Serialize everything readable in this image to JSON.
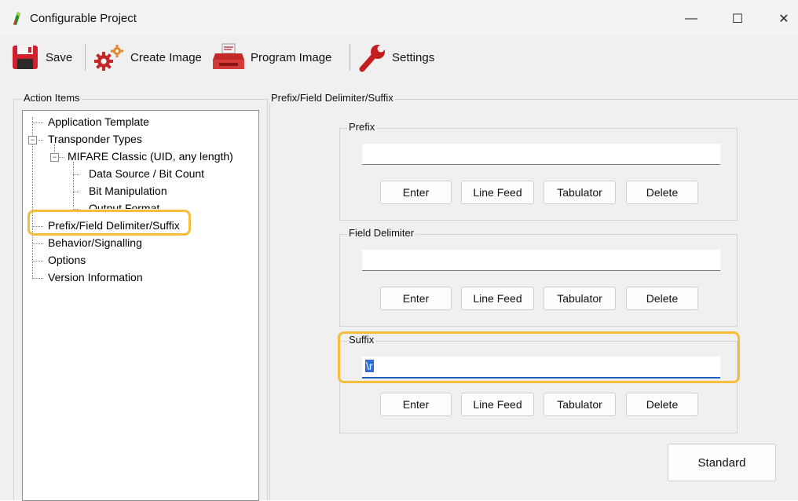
{
  "window": {
    "title": "Configurable Project"
  },
  "titlebar_buttons": {
    "minimize": "—",
    "maximize": "☐",
    "close": "✕"
  },
  "toolbar": {
    "save_label": "Save",
    "create_image_label": "Create Image",
    "program_image_label": "Program Image",
    "settings_label": "Settings"
  },
  "left_panel": {
    "title": "Action Items",
    "tree": [
      "Application Template",
      "Transponder Types",
      "MIFARE Classic (UID, any length)",
      "Data Source / Bit Count",
      "Bit Manipulation",
      "Output Format",
      "Prefix/Field Delimiter/Suffix",
      "Behavior/Signalling",
      "Options",
      "Version Information"
    ],
    "expander_symbol": "−"
  },
  "right_panel": {
    "title": "Prefix/Field Delimiter/Suffix",
    "prefix": {
      "label": "Prefix",
      "value": "",
      "buttons": [
        "Enter",
        "Line Feed",
        "Tabulator",
        "Delete"
      ]
    },
    "field_delimiter": {
      "label": "Field Delimiter",
      "value": "",
      "buttons": [
        "Enter",
        "Line Feed",
        "Tabulator",
        "Delete"
      ]
    },
    "suffix": {
      "label": "Suffix",
      "value": "\\r",
      "buttons": [
        "Enter",
        "Line Feed",
        "Tabulator",
        "Delete"
      ]
    },
    "standard_button": "Standard"
  },
  "colors": {
    "highlight": "#f6bd3d",
    "selection": "#2f6fd4",
    "save_icon": "#d21f2d"
  }
}
